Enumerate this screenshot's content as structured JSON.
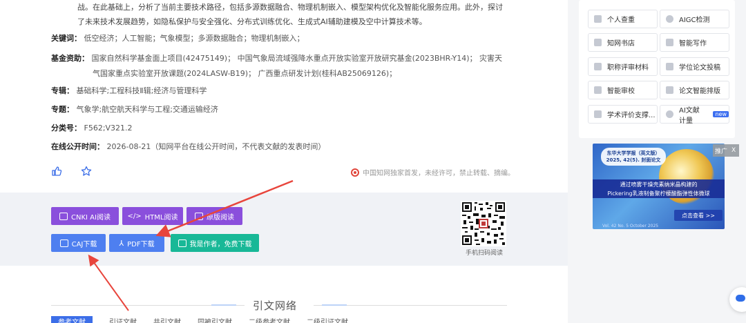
{
  "abstract": {
    "line1": "战。在此基础上，分析了当前主要技术路径，包括多源数据融合、物理机制嵌入、模型架构优化及智能化服务应用。此外，探讨",
    "line2": "了未来技术发展趋势，如隐私保护与安全强化、分布式训练优化、生成式AI辅助建模及空中计算技术等。"
  },
  "keywords": {
    "label": "关键词：",
    "value": "低空经济；人工智能；气象模型；多源数据融合；物理机制嵌入；"
  },
  "funding": {
    "label": "基金资助：",
    "line1": "国家自然科学基金面上项目(42475149)；  中国气象局流域强降水重点开放实验室开放研究基金(2023BHR-Y14)；  灾害天",
    "line2": "气国家重点实验室开放课题(2024LASW-B19)；  广西重点研发计划(桂科AB25069126)；"
  },
  "series": {
    "label": "专辑：",
    "value": "基础科学;工程科技Ⅱ辑;经济与管理科学"
  },
  "topic": {
    "label": "专题：",
    "value": "气象学;航空航天科学与工程;交通运输经济"
  },
  "classification": {
    "label": "分类号：",
    "value": "F562;V321.2"
  },
  "online_time": {
    "label": "在线公开时间：",
    "value": "2026-08-21（知网平台在线公开时间，不代表文献的发表时间）"
  },
  "notice": "中国知网独家首发，未经许可，禁止转载、摘编。",
  "buttons": {
    "cnki_ai": "CNKI AI阅读",
    "html": "HTML阅读",
    "original": "原版阅读",
    "caj": "CAJ下载",
    "pdf": "PDF下载",
    "author": "我是作者，免费下载"
  },
  "qr_label": "手机扫码阅读",
  "citation": {
    "title": "引文网络",
    "tabs": [
      "参考文献",
      "引证文献",
      "共引文献",
      "同被引文献",
      "二级参考文献",
      "二级引证文献"
    ]
  },
  "sidebar": {
    "items": [
      {
        "label": "个人查重",
        "icon": "doc-check-icon"
      },
      {
        "label": "AIGC检测",
        "icon": "aigc-icon"
      },
      {
        "label": "知网书店",
        "icon": "book-icon"
      },
      {
        "label": "智能写作",
        "icon": "pen-icon"
      },
      {
        "label": "职称评审材料",
        "icon": "file-icon"
      },
      {
        "label": "学位论文投稿",
        "icon": "upload-icon"
      },
      {
        "label": "智能审校",
        "icon": "review-icon"
      },
      {
        "label": "论文智能排版",
        "icon": "layout-icon"
      },
      {
        "label": "学术评价支撑...",
        "icon": "stack-icon"
      },
      {
        "label": "AI文献计量",
        "icon": "ai-icon",
        "badge": "new"
      }
    ]
  },
  "ad": {
    "journal": "东华大学学报（英文版）",
    "issue": "2025, 42(5). 封面论文",
    "headline1": "通过喷雾干燥壳素纳米晶构建的",
    "headline2": "Pickering乳液制备聚柠檬酸酯弹性体微球",
    "more": "点击查看 >>",
    "vol": "Vol. 42  No. 5   October 2025",
    "tag": "推广",
    "close": "X"
  },
  "colors": {
    "purple": "#8a4fdc",
    "blue": "#4e7ff0",
    "green": "#18b897",
    "arrow": "#e8453c"
  }
}
